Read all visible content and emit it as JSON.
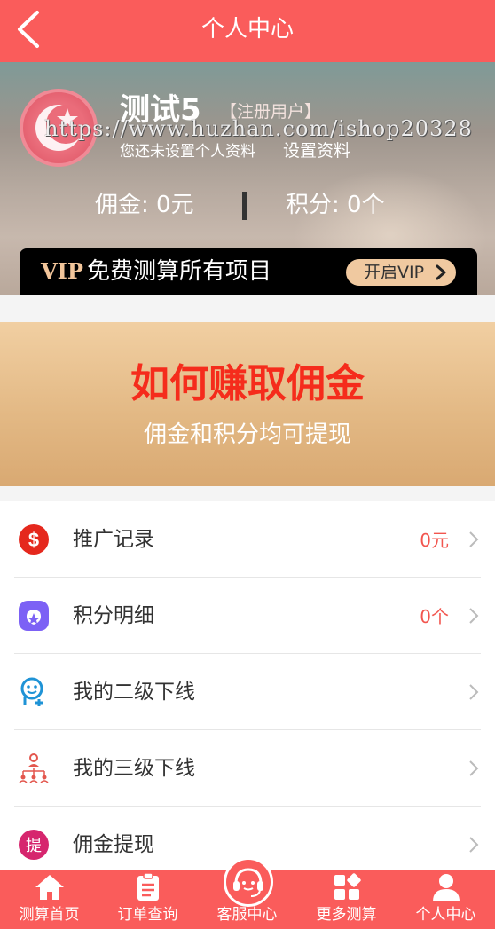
{
  "header": {
    "title": "个人中心",
    "back_icon": "back-chevron-icon"
  },
  "profile": {
    "name": "测试5",
    "tag": "【注册用户】",
    "watermark": "https://www.huzhan.com/ishop20328",
    "not_set": "您还未设置个人资料",
    "set_link": "设置资料",
    "commission": "佣金: 0元",
    "points": "积分: 0个"
  },
  "vip": {
    "logo": "VIP",
    "text": "免费测算所有项目",
    "button": "开启VIP"
  },
  "earn": {
    "title": "如何赚取佣金",
    "subtitle": "佣金和积分均可提现"
  },
  "menu": [
    {
      "label": "推广记录",
      "value": "0元",
      "icon": "dollar-icon"
    },
    {
      "label": "积分明细",
      "value": "0个",
      "icon": "points-bag-icon"
    },
    {
      "label": "我的二级下线",
      "value": "",
      "icon": "add-user-icon"
    },
    {
      "label": "我的三级下线",
      "value": "",
      "icon": "hierarchy-icon"
    },
    {
      "label": "佣金提现",
      "value": "",
      "icon": "withdraw-icon",
      "icon_text": "提"
    }
  ],
  "nav": [
    {
      "label": "测算首页",
      "icon": "home-icon"
    },
    {
      "label": "订单查询",
      "icon": "order-icon"
    },
    {
      "label": "客服中心",
      "icon": "headset-icon"
    },
    {
      "label": "更多测算",
      "icon": "grid-icon"
    },
    {
      "label": "个人中心",
      "icon": "user-icon"
    }
  ],
  "colors": {
    "brand": "#fa5c5b",
    "accent_red": "#f52c1c",
    "vip_gold": "#f0c9a0"
  }
}
